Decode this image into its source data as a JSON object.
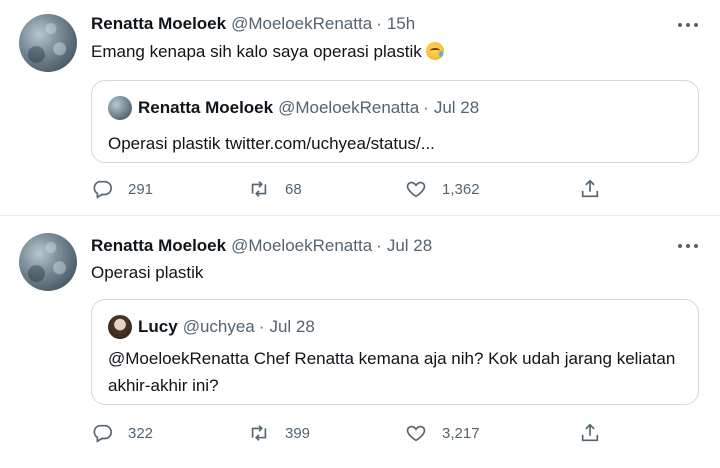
{
  "tweets": [
    {
      "name": "Renatta Moeloek",
      "handle": "@MoeloekRenatta",
      "separator": "·",
      "time": "15h",
      "text": "Emang kenapa sih kalo saya operasi plastik",
      "emoji": "crying-face-emoji",
      "quote": {
        "name": "Renatta Moeloek",
        "handle": "@MoeloekRenatta",
        "separator": "·",
        "time": "Jul 28",
        "text": "Operasi plastik twitter.com/uchyea/status/..."
      },
      "replies": "291",
      "retweets": "68",
      "likes": "1,362"
    },
    {
      "name": "Renatta Moeloek",
      "handle": "@MoeloekRenatta",
      "separator": "·",
      "time": "Jul 28",
      "text": "Operasi plastik",
      "quote": {
        "name": "Lucy",
        "handle": "@uchyea",
        "separator": "·",
        "time": "Jul 28",
        "text": "@MoeloekRenatta Chef Renatta kemana aja nih? Kok udah jarang keliatan akhir-akhir ini?"
      },
      "replies": "322",
      "retweets": "399",
      "likes": "3,217"
    }
  ],
  "colors": {
    "text_primary": "#0f1419",
    "text_secondary": "#536471",
    "border": "#cfd9de",
    "divider": "#e6ecf0"
  }
}
